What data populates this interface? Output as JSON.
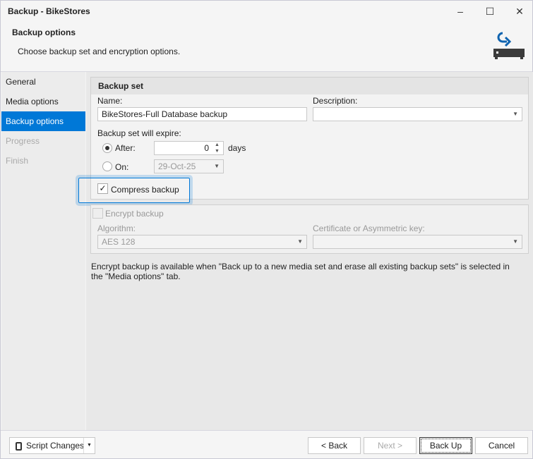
{
  "window": {
    "title": "Backup - BikeStores",
    "minimize": "–",
    "maximize": "☐",
    "close": "✕"
  },
  "header": {
    "title": "Backup options",
    "subtitle": "Choose backup set and encryption options."
  },
  "nav": {
    "items": [
      {
        "label": "General"
      },
      {
        "label": "Media options"
      },
      {
        "label": "Backup options"
      },
      {
        "label": "Progress"
      },
      {
        "label": "Finish"
      }
    ]
  },
  "backup_set": {
    "title": "Backup set",
    "name_label": "Name:",
    "name_value": "BikeStores-Full Database backup",
    "description_label": "Description:",
    "description_value": "",
    "expire_label": "Backup set will expire:",
    "after_label": "After:",
    "after_value": "0",
    "days_label": "days",
    "on_label": "On:",
    "on_value": "29-Oct-25",
    "compress_label": "Compress backup",
    "compress_checked": true
  },
  "encryption": {
    "encrypt_label": "Encrypt backup",
    "algorithm_label": "Algorithm:",
    "algorithm_value": "AES 128",
    "certificate_label": "Certificate or Asymmetric key:",
    "certificate_value": ""
  },
  "note": "Encrypt backup is available when \"Back up to a new media set and erase all existing backup sets\" is selected in the \"Media options\" tab.",
  "footer": {
    "script_label": "Script Changes",
    "back_label": "< Back",
    "next_label": "Next >",
    "backup_label": "Back Up",
    "cancel_label": "Cancel"
  },
  "colors": {
    "accent": "#0078d7"
  }
}
